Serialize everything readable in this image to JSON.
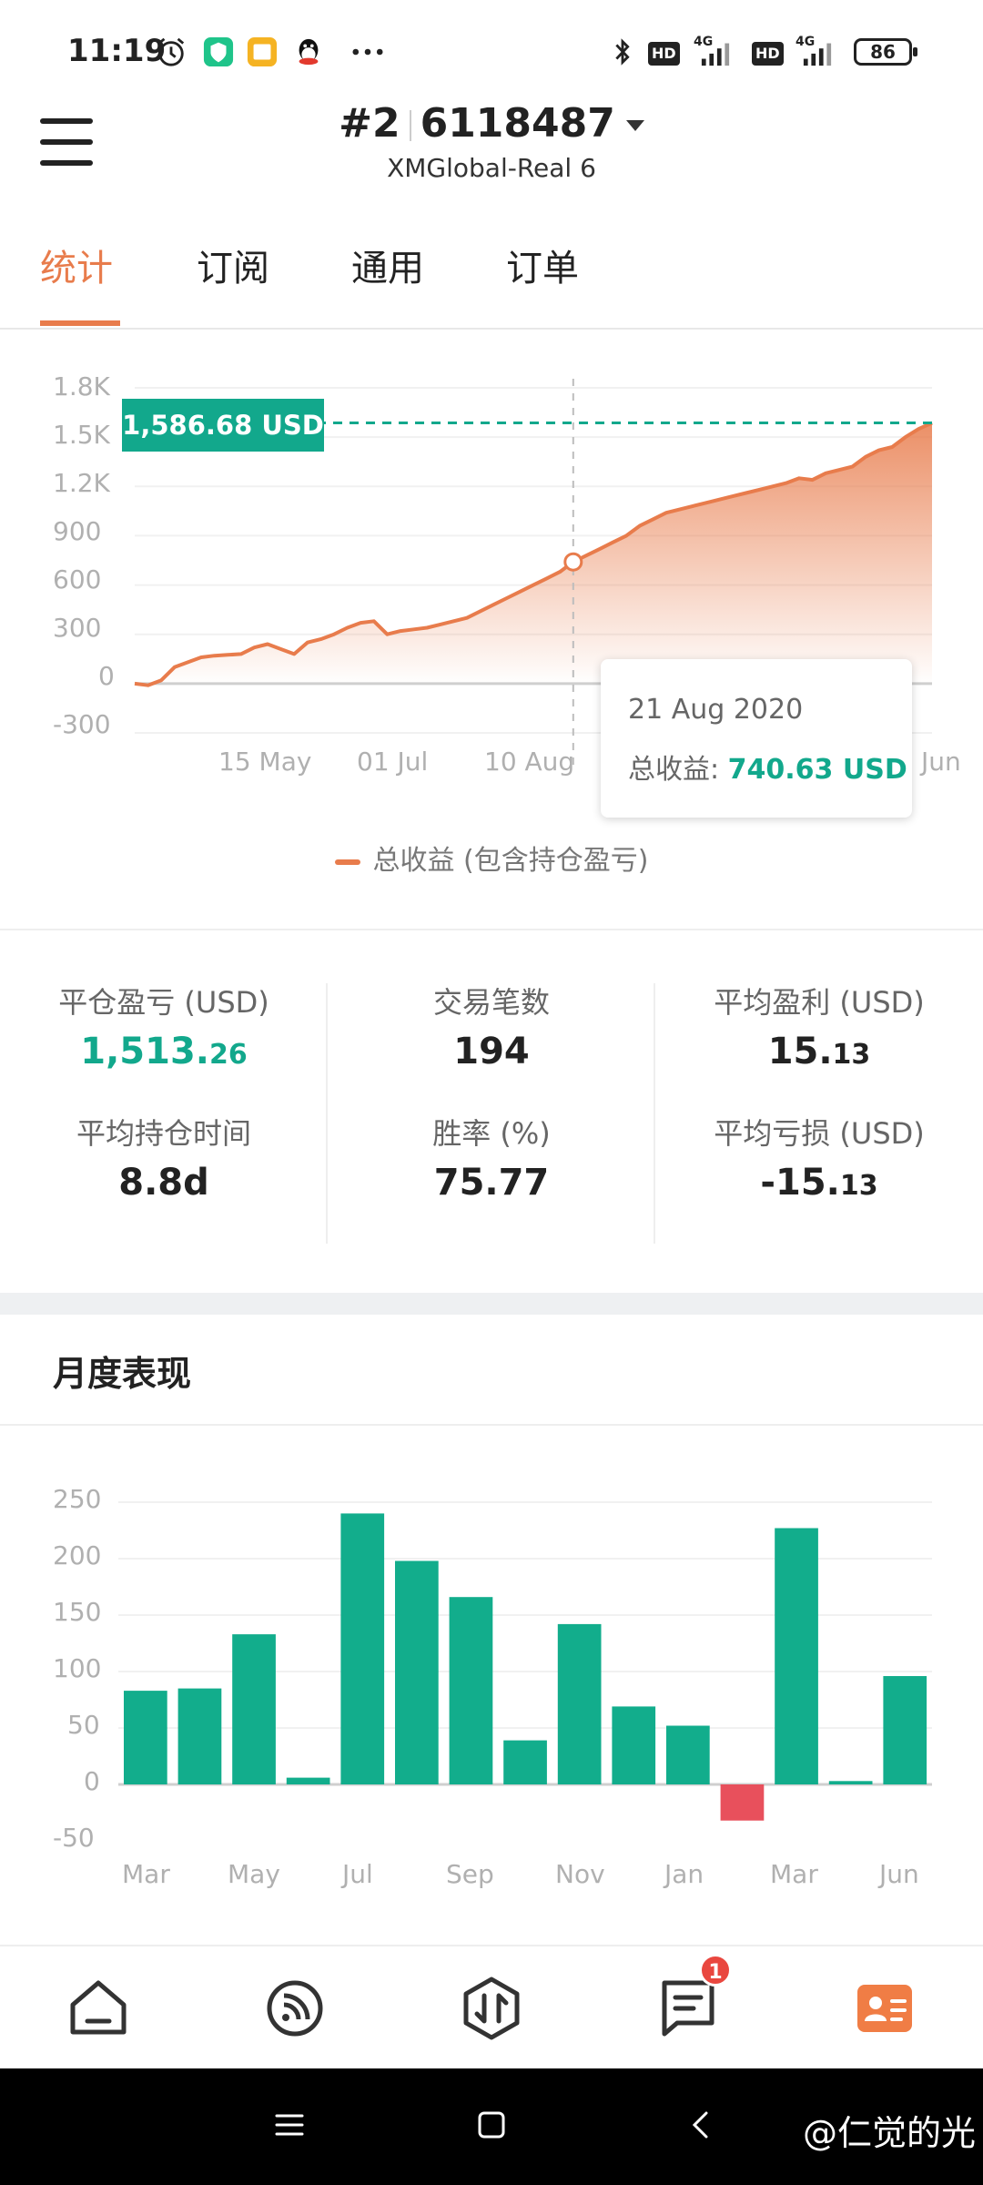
{
  "status_bar": {
    "time": "11:19",
    "icons": [
      "alarm-icon",
      "shield-app-icon",
      "notes-app-icon",
      "qq-penguin-icon",
      "more-dots-icon"
    ],
    "right_icons": [
      "bluetooth-icon",
      "hd-badge",
      "signal-4g-icon",
      "hd-badge",
      "signal-4g-icon"
    ],
    "hd_label": "HD",
    "network_label": "4G",
    "battery": "86"
  },
  "header": {
    "account_index": "#2",
    "account_number": "6118487",
    "server": "XMGlobal-Real 6"
  },
  "tabs": [
    {
      "label": "统计",
      "active": true
    },
    {
      "label": "订阅",
      "active": false
    },
    {
      "label": "通用",
      "active": false
    },
    {
      "label": "订单",
      "active": false
    }
  ],
  "equity_chart": {
    "current_value_label": "1,586.68 USD",
    "tooltip": {
      "date": "21 Aug 2020",
      "label": "总收益: ",
      "value": "740.63 USD"
    },
    "legend": "总收益 (包含持仓盈亏)",
    "accent_color": "#e87c4c",
    "highlight_color": "#12a88c"
  },
  "chart_data": [
    {
      "type": "area",
      "yticks": [
        "1.8K",
        "1.5K",
        "1.2K",
        "900",
        "600",
        "300",
        "0",
        "-300"
      ],
      "ylim": [
        -300,
        1800
      ],
      "xticks": [
        "15 May",
        "01 Jul",
        "10 Aug",
        "Jun"
      ],
      "series": [
        {
          "name": "总收益 (包含持仓盈亏)",
          "values": [
            0,
            -10,
            20,
            100,
            130,
            160,
            170,
            175,
            180,
            220,
            240,
            210,
            180,
            250,
            270,
            300,
            340,
            370,
            380,
            300,
            320,
            330,
            340,
            360,
            380,
            400,
            440,
            480,
            520,
            560,
            600,
            640,
            680,
            740.63,
            780,
            820,
            860,
            900,
            960,
            1000,
            1040,
            1060,
            1080,
            1100,
            1120,
            1140,
            1160,
            1180,
            1200,
            1220,
            1250,
            1240,
            1280,
            1300,
            1320,
            1380,
            1420,
            1440,
            1500,
            1550,
            1586.68
          ]
        }
      ],
      "highlight_value": 740.63
    },
    {
      "type": "bar",
      "yticks": [
        "250",
        "200",
        "150",
        "100",
        "50",
        "0",
        "-50"
      ],
      "ylim": [
        -50,
        250
      ],
      "xticks": [
        "Mar",
        "May",
        "Jul",
        "Sep",
        "Nov",
        "Jan",
        "Mar",
        "Jun"
      ],
      "values": [
        83,
        85,
        133,
        6,
        240,
        198,
        166,
        39,
        142,
        69,
        52,
        -32,
        227,
        3,
        96
      ]
    }
  ],
  "stats": [
    {
      "label": "平仓盈亏 (USD)",
      "value_main": "1,513.",
      "value_small": "26",
      "positive": true
    },
    {
      "label": "交易笔数",
      "value_main": "194",
      "value_small": ""
    },
    {
      "label": "平均盈利 (USD)",
      "value_main": "15.",
      "value_small": "13"
    },
    {
      "label": "平均持仓时间",
      "value_main": "8.8d",
      "value_small": ""
    },
    {
      "label": "胜率 (%)",
      "value_main": "75.77",
      "value_small": ""
    },
    {
      "label": "平均亏损 (USD)",
      "value_main": "-15.",
      "value_small": "13"
    }
  ],
  "monthly": {
    "title": "月度表现",
    "positive_color": "#12ad8c",
    "negative_color": "#e8505c"
  },
  "bottom_nav": {
    "items": [
      "home-icon",
      "subscribe-feed-icon",
      "trade-icon",
      "message-icon",
      "profile-card-icon"
    ],
    "active_index": 4,
    "message_badge": "1"
  },
  "watermark": "@仁觉的光"
}
